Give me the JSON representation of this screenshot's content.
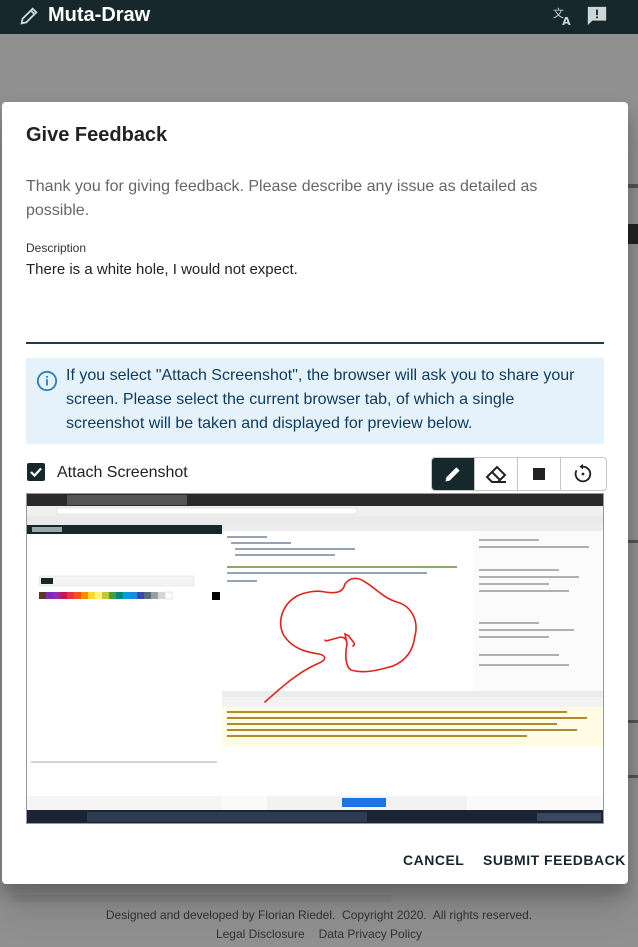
{
  "app": {
    "title": "Muta-Draw"
  },
  "icons": {
    "brand": "pencil-icon",
    "translate": "translate-icon",
    "feedback": "feedback-icon",
    "info": "info-icon",
    "checkbox": "check-icon",
    "pen": "pen-icon",
    "eraser": "eraser-icon",
    "stop": "stop-icon",
    "reset": "reset-icon"
  },
  "colors": {
    "appbar": "#17282d",
    "alert_bg": "#e5f2fb",
    "alert_text": "#0d3c61",
    "stroke": "#e0241b"
  },
  "dialog": {
    "title": "Give Feedback",
    "intro": "Thank you for giving feedback. Please describe any issue as detailed as possible.",
    "description_label": "Description",
    "description_value": "There is a white hole, I would not expect.",
    "alert_text": "If you select \"Attach Screenshot\", the browser will ask you to share your screen. Please select the current browser tab, of which a single screenshot will be taken and displayed for preview below.",
    "attach_label": "Attach Screenshot",
    "attach_checked": true,
    "cancel_label": "CANCEL",
    "submit_label": "SUBMIT FEEDBACK"
  },
  "footer": {
    "line1": "Designed and developed by Florian Riedel.  Copyright 2020.  All rights reserved.",
    "legal": "Legal Disclosure",
    "privacy": "Data Privacy Policy"
  }
}
